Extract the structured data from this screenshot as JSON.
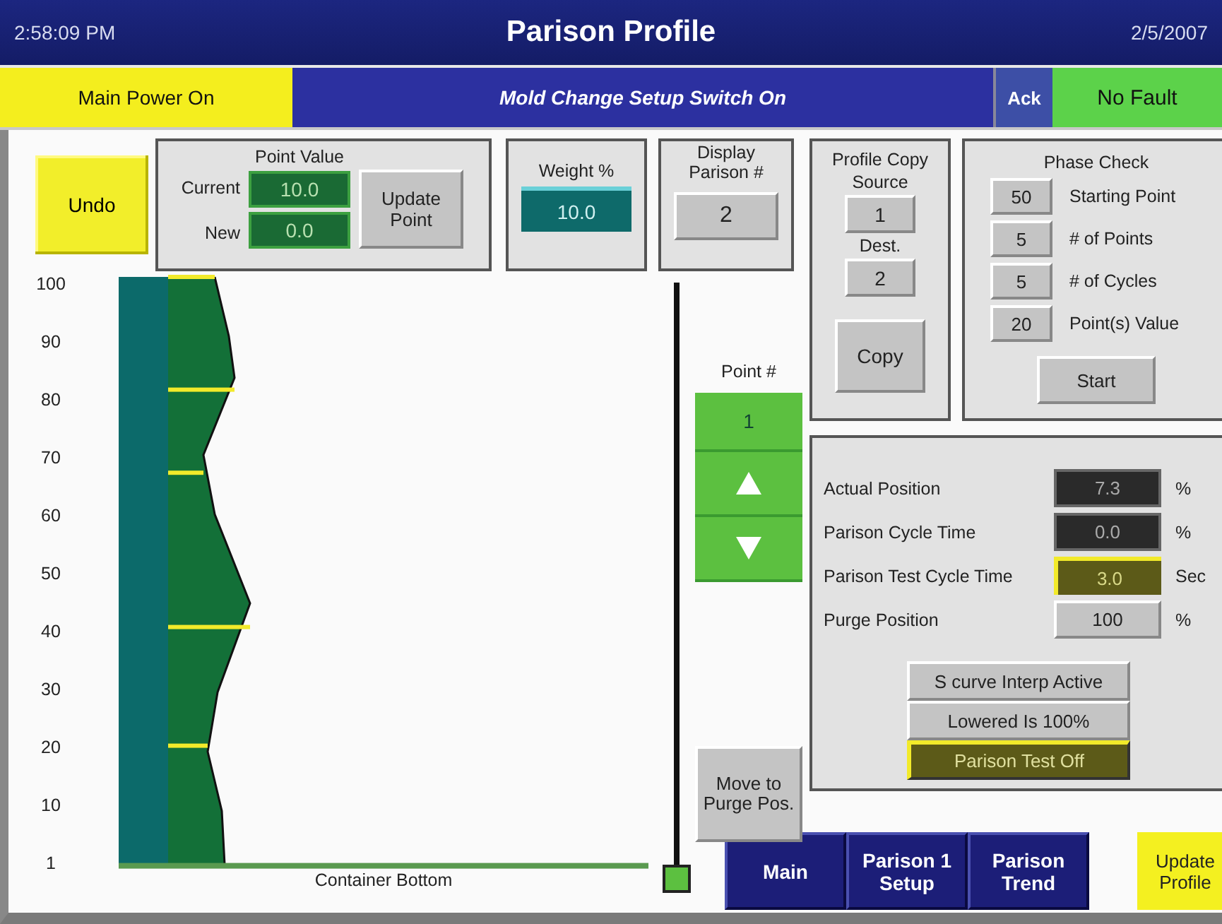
{
  "header": {
    "time": "2:58:09 PM",
    "title": "Parison Profile",
    "date": "2/5/2007"
  },
  "status_bar": [
    {
      "kind": "lamp",
      "text": "Main Power On",
      "color": "#f4ee1e"
    },
    {
      "kind": "banner",
      "text": "Mold Change Setup Switch On",
      "color": "#2c30a0"
    },
    {
      "kind": "button",
      "text": "Ack",
      "color": "#3d4fa6"
    },
    {
      "kind": "lamp",
      "text": "No Fault",
      "color": "#5cd24a"
    }
  ],
  "undo": "Undo",
  "point_value": {
    "title": "Point Value",
    "current_label": "Current",
    "current": "10.0",
    "new_label": "New",
    "new": "0.0",
    "button": "Update Point"
  },
  "weight": {
    "title": "Weight %",
    "value": "10.0"
  },
  "display_parison": {
    "title": "Display Parison #",
    "value": "2"
  },
  "profile": {
    "y_labels": [
      "100",
      "90",
      "80",
      "70",
      "60",
      "50",
      "40",
      "30",
      "20",
      "10",
      "1"
    ],
    "footer": "Container Bottom"
  },
  "point": {
    "title": "Point #",
    "value": "1",
    "level": 0
  },
  "purge_button": "Move to Purge Pos.",
  "profile_copy": {
    "title": "Profile Copy",
    "source_label": "Source",
    "source": "1",
    "dest_label": "Dest.",
    "dest": "2",
    "button": "Copy"
  },
  "phase_check": {
    "title": "Phase Check",
    "rows": [
      {
        "value": "50",
        "label": "Starting Point"
      },
      {
        "value": "5",
        "label": "# of Points"
      },
      {
        "value": "5",
        "label": "# of Cycles"
      },
      {
        "value": "20",
        "label": "Point(s) Value"
      }
    ],
    "button": "Start"
  },
  "readouts": [
    {
      "kind": "display",
      "label": "Actual Position",
      "value": "7.3",
      "unit": "%"
    },
    {
      "kind": "display",
      "label": "Parison Cycle Time",
      "value": "0.0",
      "unit": "%"
    },
    {
      "kind": "active",
      "label": "Parison Test Cycle Time",
      "value": "3.0",
      "unit": "Sec"
    },
    {
      "kind": "input",
      "label": "Purge Position",
      "value": "100",
      "unit": "%"
    }
  ],
  "toggles": [
    {
      "text": "S curve Interp Active",
      "on": false
    },
    {
      "text": "Lowered Is 100%",
      "on": false
    },
    {
      "text": "Parison Test Off",
      "on": true
    }
  ],
  "nav": [
    {
      "label": "Main"
    },
    {
      "label": "Parison 1 Setup"
    },
    {
      "label": "Parison Trend"
    }
  ],
  "update_profile": "Update Profile"
}
